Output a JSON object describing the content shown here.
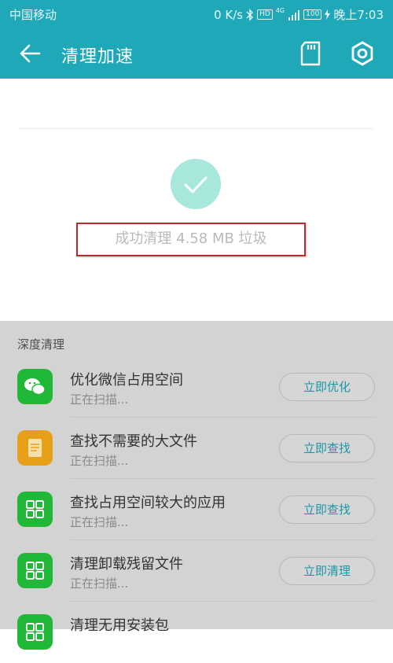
{
  "status_bar": {
    "carrier": "中国移动",
    "speed": "0 K/s",
    "hd": "HD",
    "network": "4G",
    "battery": "100",
    "time": "晚上7:03"
  },
  "toolbar": {
    "title": "清理加速",
    "back_icon": "arrow-left-icon",
    "sd_icon": "sd-card-icon",
    "settings_icon": "gear-icon"
  },
  "result": {
    "text": "成功清理 4.58 MB 垃圾",
    "check_icon": "checkmark-icon"
  },
  "deep_clean": {
    "title": "深度清理",
    "items": [
      {
        "name": "优化微信占用空间",
        "status": "正在扫描...",
        "button": "立即优化",
        "icon": "wechat-icon",
        "color": "#21b838"
      },
      {
        "name": "查找不需要的大文件",
        "status": "正在扫描...",
        "button": "立即查找",
        "icon": "document-icon",
        "color": "#e7a118"
      },
      {
        "name": "查找占用空间较大的应用",
        "status": "正在扫描...",
        "button": "立即查找",
        "icon": "apps-grid-icon",
        "color": "#21b838"
      },
      {
        "name": "清理卸载残留文件",
        "status": "正在扫描...",
        "button": "立即清理",
        "icon": "apps-grid-icon",
        "color": "#21b838"
      },
      {
        "name": "清理无用安装包",
        "status": "",
        "button": "",
        "icon": "apps-grid-icon",
        "color": "#21b838"
      }
    ]
  },
  "colors": {
    "accent": "#1fa9b8",
    "check": "#a8e8dc",
    "highlight_box": "#c0292b"
  }
}
